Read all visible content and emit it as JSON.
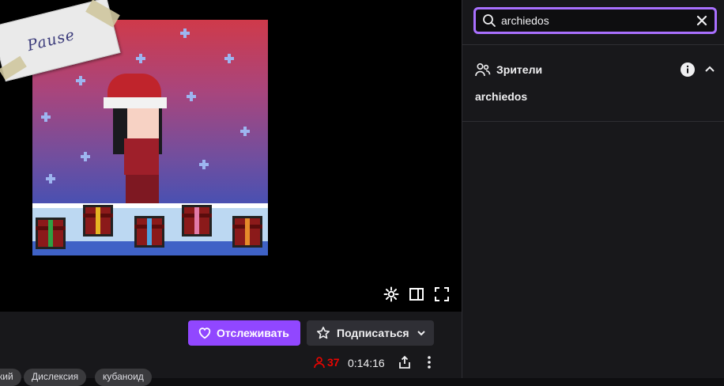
{
  "player": {
    "overlay_label": "Pause",
    "controls": {
      "settings_icon": "gear-icon",
      "theatre_icon": "theatre-mode-icon",
      "fullscreen_icon": "fullscreen-icon"
    }
  },
  "actions": {
    "follow_label": "Отслеживать",
    "subscribe_label": "Подписаться"
  },
  "stream_info": {
    "viewer_count": "37",
    "uptime": "0:14:16"
  },
  "tags": [
    "кий",
    "Дислексия",
    "кубаноид"
  ],
  "sidebar": {
    "search": {
      "value": "archiedos"
    },
    "section": {
      "title": "Зрители",
      "users": [
        "archiedos"
      ]
    }
  },
  "colors": {
    "accent": "#9147ff",
    "search_border": "#a970ff",
    "viewer_count": "#eb0400",
    "background": "#0e0e10",
    "panel": "#18181b"
  }
}
